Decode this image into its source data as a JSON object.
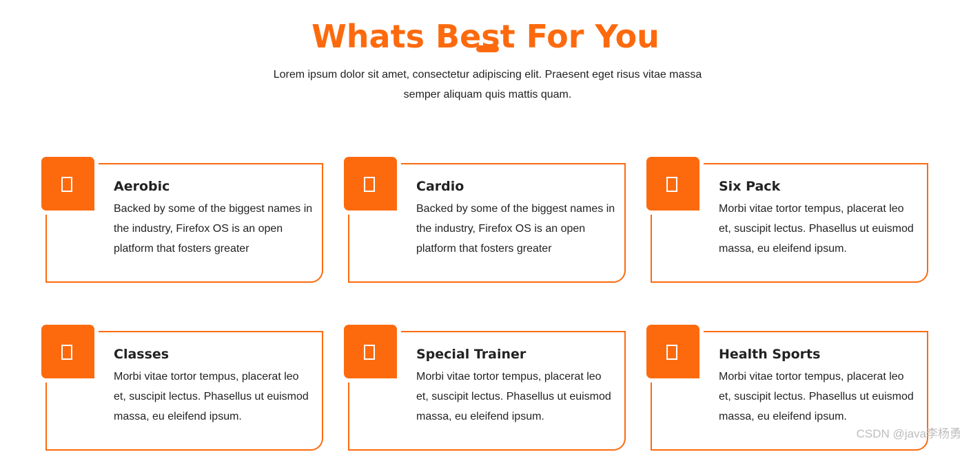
{
  "section": {
    "title": "Whats Best For You",
    "subtitle_line1": "Lorem ipsum dolor sit amet, consectetur adipiscing elit. Praesent eget risus vitae massa",
    "subtitle_line2": "semper aliquam quis mattis quam."
  },
  "cards": [
    {
      "title": "Aerobic",
      "text": "Backed by some of the biggest names in the industry, Firefox OS is an open platform that fosters greater",
      "icon": "missing-glyph-icon"
    },
    {
      "title": "Cardio",
      "text": "Backed by some of the biggest names in the industry, Firefox OS is an open platform that fosters greater",
      "icon": "missing-glyph-icon"
    },
    {
      "title": "Six Pack",
      "text": "Morbi vitae tortor tempus, placerat leo et, suscipit lectus. Phasellus ut euismod massa, eu eleifend ipsum.",
      "icon": "missing-glyph-icon"
    },
    {
      "title": "Classes",
      "text": "Morbi vitae tortor tempus, placerat leo et, suscipit lectus. Phasellus ut euismod massa, eu eleifend ipsum.",
      "icon": "missing-glyph-icon"
    },
    {
      "title": "Special Trainer",
      "text": "Morbi vitae tortor tempus, placerat leo et, suscipit lectus. Phasellus ut euismod massa, eu eleifend ipsum.",
      "icon": "missing-glyph-icon"
    },
    {
      "title": "Health Sports",
      "text": "Morbi vitae tortor tempus, placerat leo et, suscipit lectus. Phasellus ut euismod massa, eu eleifend ipsum.",
      "icon": "missing-glyph-icon"
    }
  ],
  "watermark": "CSDN @java李杨勇",
  "colors": {
    "accent": "#fd6a0e",
    "text": "#222222",
    "watermark": "#bdbdbd"
  }
}
